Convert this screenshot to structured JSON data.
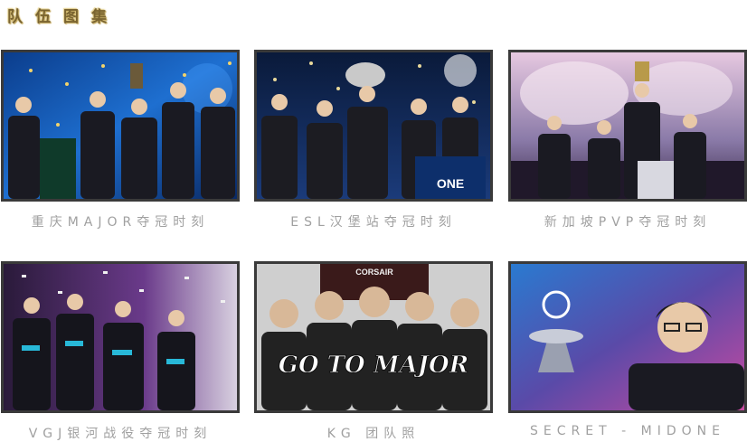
{
  "section": {
    "title_chars": [
      "队",
      "伍",
      "图",
      "集"
    ]
  },
  "gallery": {
    "items": [
      {
        "caption": "重庆MAJOR夺冠时刻",
        "image": "team-celebration-photo"
      },
      {
        "caption": "ESL汉堡站夺冠时刻",
        "image": "team-trophy-stage-photo"
      },
      {
        "caption": "新加坡PVP夺冠时刻",
        "image": "team-trophy-smoke-photo"
      },
      {
        "caption": "VGJ银河战役夺冠时刻",
        "image": "team-confetti-photo"
      },
      {
        "caption": "KG 团队照",
        "image": "team-poster-photo",
        "sign_text": "CORSAIR",
        "overlay_text": "GO TO MAJOR"
      },
      {
        "caption": "SECRET - MIDONE",
        "image": "player-portrait-photo"
      }
    ]
  },
  "colors": {
    "title_gold": "#7a6430",
    "caption_gray": "#a0a0a0",
    "frame_border": "#3a3a3a"
  }
}
